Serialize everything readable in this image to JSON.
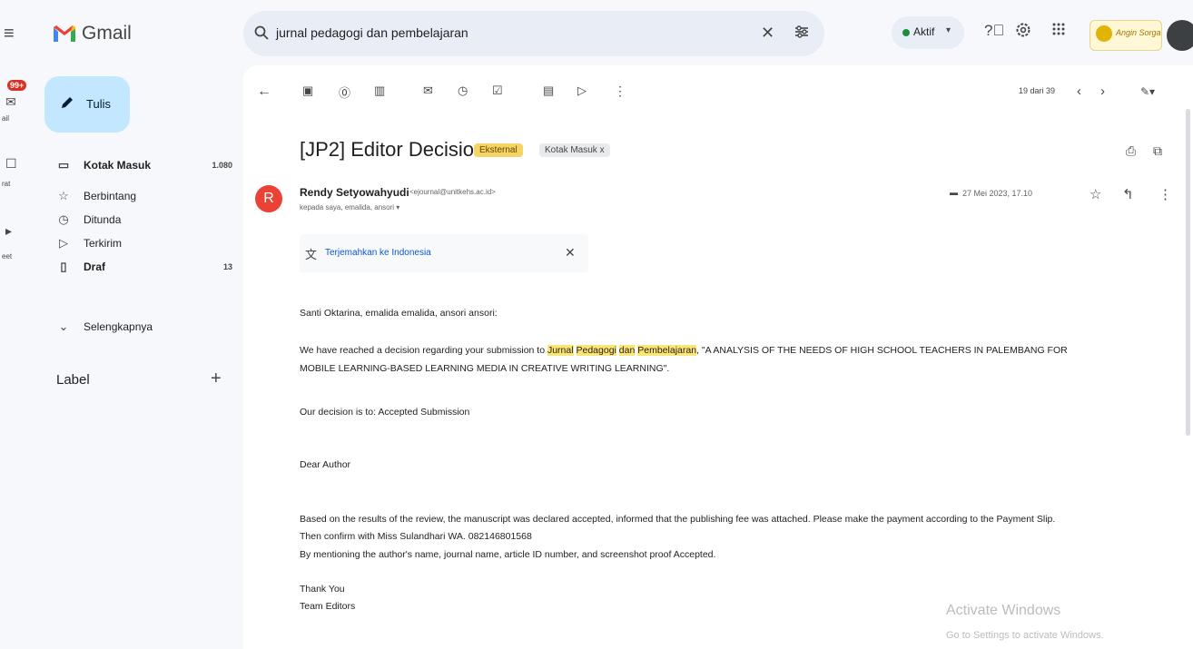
{
  "app": {
    "name": "Gmail",
    "brand_colors": {
      "red": "#ea4335",
      "blue": "#4285f4",
      "yellow": "#fbbc04",
      "green": "#34a853"
    }
  },
  "rail": {
    "badge": "99+",
    "items": [
      {
        "label": "ail",
        "icon": "mail-icon"
      },
      {
        "label": "rat",
        "icon": "chat-icon"
      },
      {
        "label": "eet",
        "icon": "meet-icon"
      }
    ]
  },
  "search": {
    "query": "jurnal pedagogi dan pembelajaran"
  },
  "status": {
    "label": "Aktif"
  },
  "logo": {
    "text": "Angin Sorga"
  },
  "compose": {
    "label": "Tulis"
  },
  "nav": {
    "items": [
      {
        "label": "Kotak Masuk",
        "count": "1.080",
        "icon": "inbox-icon",
        "bold": true
      },
      {
        "label": "Berbintang",
        "count": "",
        "icon": "star-icon",
        "bold": false
      },
      {
        "label": "Ditunda",
        "count": "",
        "icon": "clock-icon",
        "bold": false
      },
      {
        "label": "Terkirim",
        "count": "",
        "icon": "send-icon",
        "bold": false
      },
      {
        "label": "Draf",
        "count": "13",
        "icon": "draft-icon",
        "bold": true
      },
      {
        "label": "Selengkapnya",
        "count": "",
        "icon": "chevron-down-icon",
        "bold": false
      }
    ],
    "label_heading": "Label",
    "label_add": "+"
  },
  "toolbar": {
    "pager": "19 dari 39"
  },
  "message": {
    "subject": "[JP2] Editor Decision",
    "tag_external": "Eksternal",
    "tag_inbox": "Kotak Masuk x",
    "sender_initial": "R",
    "sender_name": "Rendy Setyowahyudi",
    "sender_email": "<ejournal@unitkehs.ac.id>",
    "to_line": "kepada saya, emalida, ansori ▾",
    "date": "27 Mei 2023, 17.10",
    "translate_label": "Terjemahkan ke Indonesia",
    "greeting": "Santi Oktarina, emalida emalida, ansori ansori:",
    "para1_pre": "We have reached a decision regarding your submission to ",
    "para1_hl1": "Jurnal",
    "para1_hl2": "Pedagogi",
    "para1_hl3": "dan",
    "para1_hl4": "Pembelajaran",
    "para1_post": ", \"A ANALYSIS OF THE NEEDS OF HIGH SCHOOL TEACHERS IN PALEMBANG FOR",
    "para1_line2": "MOBILE LEARNING-BASED LEARNING MEDIA IN CREATIVE WRITING LEARNING\".",
    "decision": "Our decision is to: Accepted Submission",
    "salutation": "Dear Author",
    "p2_line1": "Based on the results of the review, the manuscript was declared accepted, informed that the publishing fee was attached. Please make the payment according to the Payment Slip.",
    "p2_line2": "Then confirm with Miss Sulandhari WA. 082146801568",
    "p2_line3": "By mentioning the author's name, journal name, article ID number, and screenshot proof Accepted.",
    "closing1": "Thank You",
    "closing2": "Team Editors"
  },
  "watermark": {
    "line1": "Activate Windows",
    "line2": "Go to Settings to activate Windows."
  }
}
